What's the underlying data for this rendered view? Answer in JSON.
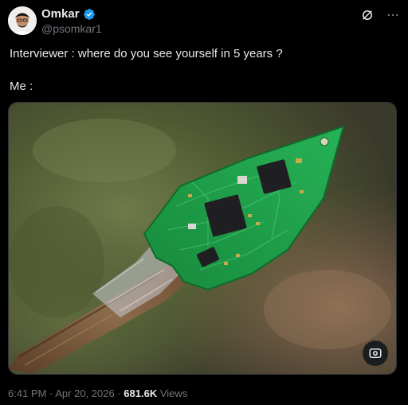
{
  "author": {
    "display_name": "Omkar",
    "handle": "@psomkar1",
    "verified": true,
    "avatar_icon": "profile-avatar-icon"
  },
  "header_actions": {
    "grok_icon": "grok-icon",
    "more_icon": "more-options-icon"
  },
  "tweet": {
    "line1": "Interviewer : where do you see yourself in 5 years ?",
    "line2": "Me :"
  },
  "media": {
    "image_icon": "photo-image",
    "alt_button_icon": "image-tools-icon"
  },
  "meta": {
    "time": "6:41 PM",
    "sep1": " · ",
    "date": "Apr 20, 2026",
    "sep2": " · ",
    "views_count": "681.6K",
    "views_label": " Views"
  },
  "colors": {
    "background": "#000000",
    "text_primary": "#e7e9ea",
    "text_secondary": "#71767b",
    "verified_blue": "#1d9bf0",
    "pcb_green": "#1e9e4a"
  }
}
